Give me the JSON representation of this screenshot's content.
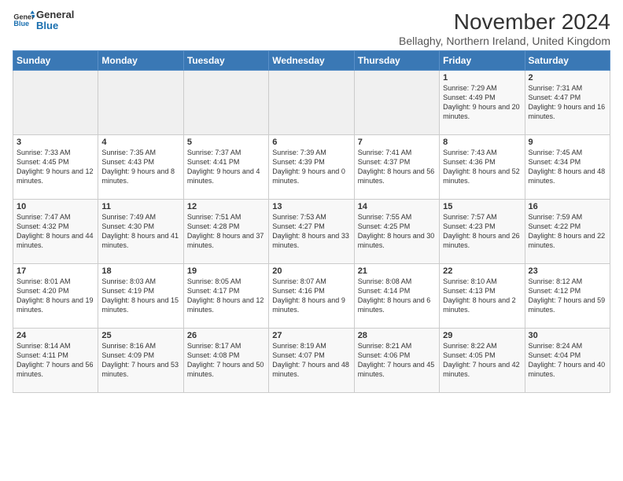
{
  "logo": {
    "line1": "General",
    "line2": "Blue"
  },
  "title": "November 2024",
  "subtitle": "Bellaghy, Northern Ireland, United Kingdom",
  "days_of_week": [
    "Sunday",
    "Monday",
    "Tuesday",
    "Wednesday",
    "Thursday",
    "Friday",
    "Saturday"
  ],
  "weeks": [
    [
      {
        "day": "",
        "info": ""
      },
      {
        "day": "",
        "info": ""
      },
      {
        "day": "",
        "info": ""
      },
      {
        "day": "",
        "info": ""
      },
      {
        "day": "",
        "info": ""
      },
      {
        "day": "1",
        "info": "Sunrise: 7:29 AM\nSunset: 4:49 PM\nDaylight: 9 hours and 20 minutes."
      },
      {
        "day": "2",
        "info": "Sunrise: 7:31 AM\nSunset: 4:47 PM\nDaylight: 9 hours and 16 minutes."
      }
    ],
    [
      {
        "day": "3",
        "info": "Sunrise: 7:33 AM\nSunset: 4:45 PM\nDaylight: 9 hours and 12 minutes."
      },
      {
        "day": "4",
        "info": "Sunrise: 7:35 AM\nSunset: 4:43 PM\nDaylight: 9 hours and 8 minutes."
      },
      {
        "day": "5",
        "info": "Sunrise: 7:37 AM\nSunset: 4:41 PM\nDaylight: 9 hours and 4 minutes."
      },
      {
        "day": "6",
        "info": "Sunrise: 7:39 AM\nSunset: 4:39 PM\nDaylight: 9 hours and 0 minutes."
      },
      {
        "day": "7",
        "info": "Sunrise: 7:41 AM\nSunset: 4:37 PM\nDaylight: 8 hours and 56 minutes."
      },
      {
        "day": "8",
        "info": "Sunrise: 7:43 AM\nSunset: 4:36 PM\nDaylight: 8 hours and 52 minutes."
      },
      {
        "day": "9",
        "info": "Sunrise: 7:45 AM\nSunset: 4:34 PM\nDaylight: 8 hours and 48 minutes."
      }
    ],
    [
      {
        "day": "10",
        "info": "Sunrise: 7:47 AM\nSunset: 4:32 PM\nDaylight: 8 hours and 44 minutes."
      },
      {
        "day": "11",
        "info": "Sunrise: 7:49 AM\nSunset: 4:30 PM\nDaylight: 8 hours and 41 minutes."
      },
      {
        "day": "12",
        "info": "Sunrise: 7:51 AM\nSunset: 4:28 PM\nDaylight: 8 hours and 37 minutes."
      },
      {
        "day": "13",
        "info": "Sunrise: 7:53 AM\nSunset: 4:27 PM\nDaylight: 8 hours and 33 minutes."
      },
      {
        "day": "14",
        "info": "Sunrise: 7:55 AM\nSunset: 4:25 PM\nDaylight: 8 hours and 30 minutes."
      },
      {
        "day": "15",
        "info": "Sunrise: 7:57 AM\nSunset: 4:23 PM\nDaylight: 8 hours and 26 minutes."
      },
      {
        "day": "16",
        "info": "Sunrise: 7:59 AM\nSunset: 4:22 PM\nDaylight: 8 hours and 22 minutes."
      }
    ],
    [
      {
        "day": "17",
        "info": "Sunrise: 8:01 AM\nSunset: 4:20 PM\nDaylight: 8 hours and 19 minutes."
      },
      {
        "day": "18",
        "info": "Sunrise: 8:03 AM\nSunset: 4:19 PM\nDaylight: 8 hours and 15 minutes."
      },
      {
        "day": "19",
        "info": "Sunrise: 8:05 AM\nSunset: 4:17 PM\nDaylight: 8 hours and 12 minutes."
      },
      {
        "day": "20",
        "info": "Sunrise: 8:07 AM\nSunset: 4:16 PM\nDaylight: 8 hours and 9 minutes."
      },
      {
        "day": "21",
        "info": "Sunrise: 8:08 AM\nSunset: 4:14 PM\nDaylight: 8 hours and 6 minutes."
      },
      {
        "day": "22",
        "info": "Sunrise: 8:10 AM\nSunset: 4:13 PM\nDaylight: 8 hours and 2 minutes."
      },
      {
        "day": "23",
        "info": "Sunrise: 8:12 AM\nSunset: 4:12 PM\nDaylight: 7 hours and 59 minutes."
      }
    ],
    [
      {
        "day": "24",
        "info": "Sunrise: 8:14 AM\nSunset: 4:11 PM\nDaylight: 7 hours and 56 minutes."
      },
      {
        "day": "25",
        "info": "Sunrise: 8:16 AM\nSunset: 4:09 PM\nDaylight: 7 hours and 53 minutes."
      },
      {
        "day": "26",
        "info": "Sunrise: 8:17 AM\nSunset: 4:08 PM\nDaylight: 7 hours and 50 minutes."
      },
      {
        "day": "27",
        "info": "Sunrise: 8:19 AM\nSunset: 4:07 PM\nDaylight: 7 hours and 48 minutes."
      },
      {
        "day": "28",
        "info": "Sunrise: 8:21 AM\nSunset: 4:06 PM\nDaylight: 7 hours and 45 minutes."
      },
      {
        "day": "29",
        "info": "Sunrise: 8:22 AM\nSunset: 4:05 PM\nDaylight: 7 hours and 42 minutes."
      },
      {
        "day": "30",
        "info": "Sunrise: 8:24 AM\nSunset: 4:04 PM\nDaylight: 7 hours and 40 minutes."
      }
    ]
  ]
}
